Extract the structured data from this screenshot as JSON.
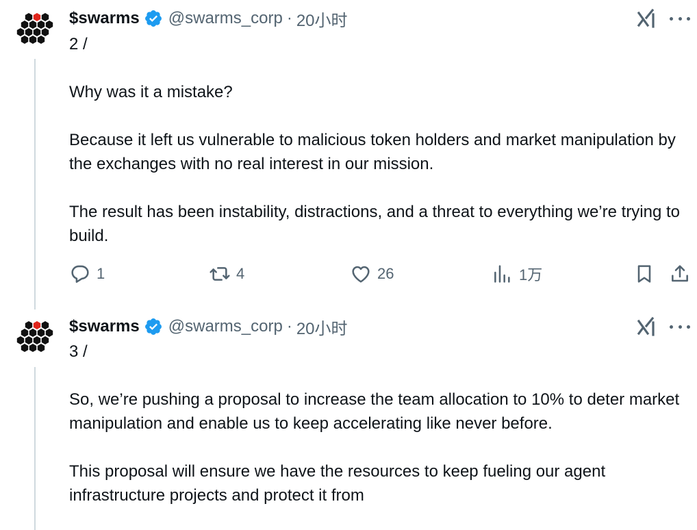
{
  "tweets": [
    {
      "display_name": "$swarms",
      "handle": "@swarms_corp",
      "separator": "·",
      "time": "20小时",
      "verified": true,
      "paragraphs": [
        "2 /",
        "",
        "Why was it a mistake?",
        "",
        "Because it left us vulnerable to malicious token holders and market manipulation by the exchanges with no real interest in our mission.",
        "",
        "The result has been instability, distractions, and a threat to everything we’re trying to build."
      ],
      "actions": {
        "replies": "1",
        "retweets": "4",
        "likes": "26",
        "views": "1万"
      }
    },
    {
      "display_name": "$swarms",
      "handle": "@swarms_corp",
      "separator": "·",
      "time": "20小时",
      "verified": true,
      "paragraphs": [
        "3 /",
        "",
        "So, we’re pushing a proposal to increase the team allocation to 10% to deter market manipulation and enable us to keep accelerating like never before.",
        "",
        "This proposal will ensure we have the resources to keep fueling our agent infrastructure projects and protect it from"
      ]
    }
  ],
  "icons": {
    "avatar": "hexagon-cluster-logo",
    "verified": "verified-badge-icon",
    "grok": "grok-icon",
    "more": "more-dots-icon",
    "reply": "reply-icon",
    "retweet": "retweet-icon",
    "like": "heart-icon",
    "views": "views-icon",
    "bookmark": "bookmark-icon",
    "share": "share-icon"
  },
  "colors": {
    "text": "#0f1419",
    "secondary": "#536471",
    "verified_blue": "#1d9bf0",
    "avatar_red": "#e0251c",
    "thread_line": "#cfd9de"
  }
}
